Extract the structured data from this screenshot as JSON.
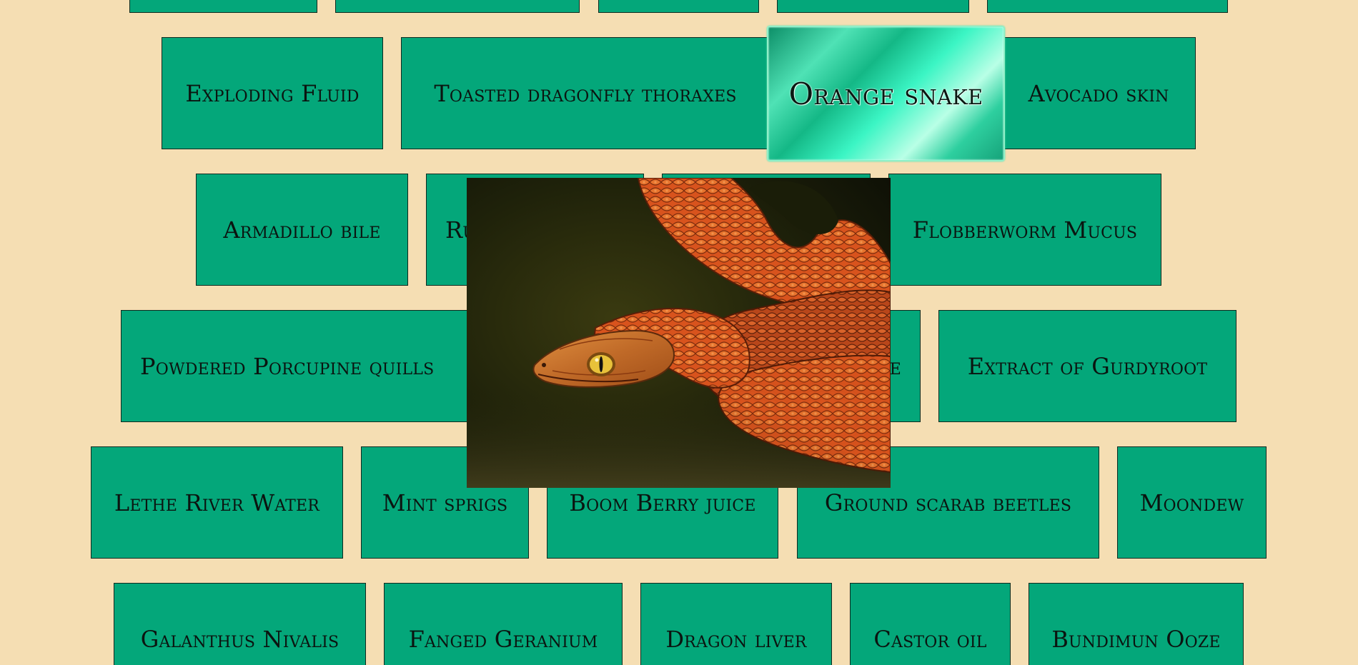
{
  "colors": {
    "background": "#f5deb3",
    "tile": "#04a77a",
    "tile_border": "#0e2a1f",
    "selected_highlight": "#3bf5c4"
  },
  "tiles": {
    "row1": [
      "",
      "",
      "",
      "",
      ""
    ],
    "exploding_fluid": "Exploding Fluid",
    "toasted_dragonfly": "Toasted dragonfly thoraxes",
    "orange_snake": "Orange snake",
    "avocado_skin": "Avocado skin",
    "armadillo_bile": "Armadillo bile",
    "ru_partial": "Ru",
    "hidden_row3": "",
    "flobberworm_mucus": "Flobberworm Mucus",
    "powdered_porcupine": "Powdered Porcupine quills",
    "row4_partial": "e",
    "extract_gurdyroot": "Extract of Gurdyroot",
    "lethe_river": "Lethe River Water",
    "mint_sprigs": "Mint sprigs",
    "boom_berry": "Boom Berry juice",
    "ground_scarab": "Ground scarab beetles",
    "moondew": "Moondew",
    "galanthus_nivalis": "Galanthus Nivalis",
    "fanged_geranium": "Fanged Geranium",
    "dragon_liver": "Dragon liver",
    "castor_oil": "Castor oil",
    "bundimun_ooze": "Bundimun Ooze"
  },
  "selected": "orange_snake",
  "preview": {
    "subject": "orange-snake-photo"
  }
}
